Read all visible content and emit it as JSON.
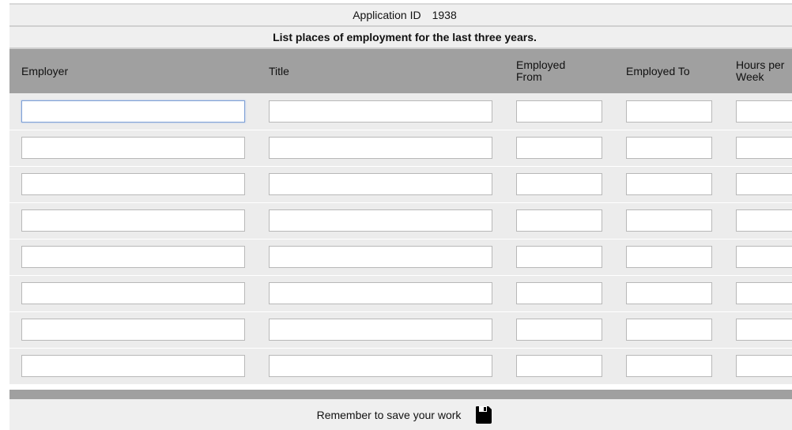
{
  "header": {
    "app_id_label": "Application ID",
    "app_id_value": "1938",
    "instruction": "List places of employment for the last three years."
  },
  "table": {
    "columns": [
      {
        "key": "employer",
        "label": "Employer"
      },
      {
        "key": "title",
        "label": "Title"
      },
      {
        "key": "employed_from",
        "label": "Employed From"
      },
      {
        "key": "employed_to",
        "label": "Employed To"
      },
      {
        "key": "hours_per_week",
        "label": "Hours per Week"
      }
    ],
    "rows": [
      {
        "employer": "",
        "title": "",
        "employed_from": "",
        "employed_to": "",
        "hours_per_week": ""
      },
      {
        "employer": "",
        "title": "",
        "employed_from": "",
        "employed_to": "",
        "hours_per_week": ""
      },
      {
        "employer": "",
        "title": "",
        "employed_from": "",
        "employed_to": "",
        "hours_per_week": ""
      },
      {
        "employer": "",
        "title": "",
        "employed_from": "",
        "employed_to": "",
        "hours_per_week": ""
      },
      {
        "employer": "",
        "title": "",
        "employed_from": "",
        "employed_to": "",
        "hours_per_week": ""
      },
      {
        "employer": "",
        "title": "",
        "employed_from": "",
        "employed_to": "",
        "hours_per_week": ""
      },
      {
        "employer": "",
        "title": "",
        "employed_from": "",
        "employed_to": "",
        "hours_per_week": ""
      },
      {
        "employer": "",
        "title": "",
        "employed_from": "",
        "employed_to": "",
        "hours_per_week": ""
      }
    ],
    "focused_cell": {
      "row": 0,
      "column": "employer"
    }
  },
  "footer": {
    "reminder": "Remember to save your work",
    "save_icon": "floppy-disk-icon"
  }
}
